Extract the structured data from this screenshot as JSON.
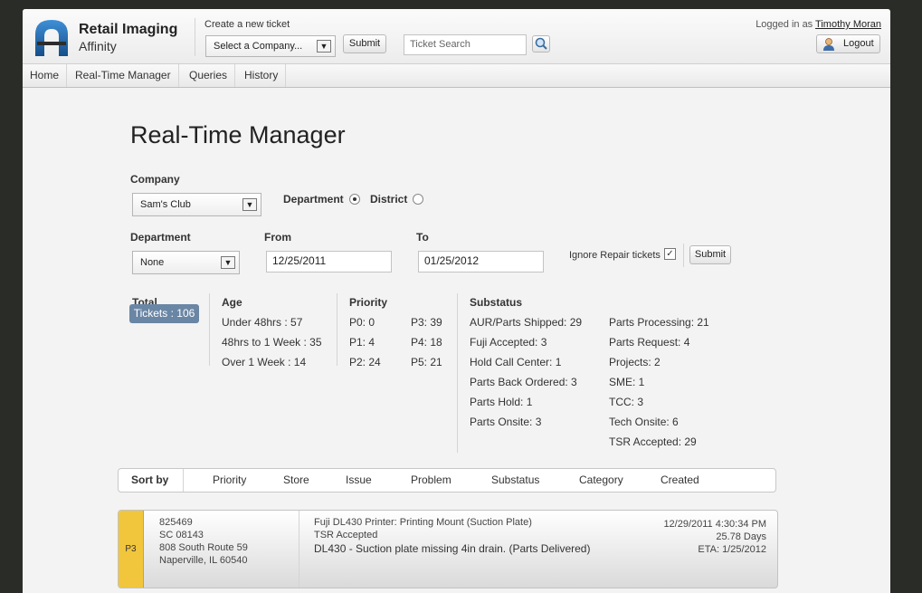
{
  "brand": {
    "title": "Retail Imaging",
    "subtitle": "Affinity"
  },
  "header": {
    "create_label": "Create a new ticket",
    "company_select": "Select a Company...",
    "submit": "Submit",
    "search_placeholder": "Ticket Search",
    "logged_prefix": "Logged in as",
    "user": "Timothy Moran",
    "logout": "Logout"
  },
  "nav": [
    "Home",
    "Real-Time Manager",
    "Queries",
    "History"
  ],
  "page_title": "Real-Time Manager",
  "filters": {
    "company_label": "Company",
    "company_value": "Sam's Club",
    "department_radio": "Department",
    "district_radio": "District",
    "mode_selected": "Department",
    "department_label": "Department",
    "department_value": "None",
    "from_label": "From",
    "from_value": "12/25/2011",
    "to_label": "To",
    "to_value": "01/25/2012",
    "ignore_repair_label": "Ignore Repair tickets",
    "ignore_repair_checked": true,
    "submit": "Submit"
  },
  "stats": {
    "total_label": "Total",
    "tickets": "Tickets : 106",
    "age_label": "Age",
    "age": [
      "Under 48hrs : 57",
      "48hrs to 1 Week : 35",
      "Over 1 Week : 14"
    ],
    "priority_label": "Priority",
    "priority_left": [
      "P0: 0",
      "P1: 4",
      "P2: 24"
    ],
    "priority_right": [
      "P3: 39",
      "P4: 18",
      "P5: 21"
    ],
    "substatus_label": "Substatus",
    "substatus_left": [
      "AUR/Parts Shipped: 29",
      "Fuji Accepted: 3",
      "Hold Call Center: 1",
      "Parts Back Ordered: 3",
      "Parts Hold: 1",
      "Parts Onsite: 3"
    ],
    "substatus_right": [
      "Parts Processing: 21",
      "Parts Request: 4",
      "Projects: 2",
      "SME: 1",
      "TCC: 3",
      "Tech Onsite: 6",
      "TSR Accepted: 29"
    ]
  },
  "sort": {
    "label": "Sort by",
    "items": [
      "Priority",
      "Store",
      "Issue",
      "Problem",
      "Substatus",
      "Category",
      "Created"
    ]
  },
  "ticket": {
    "priority": "P3",
    "id": "825469",
    "store": "SC 08143",
    "address": "808 South Route 59",
    "city": "Naperville, IL 60540",
    "category": "Fuji DL430 Printer: Printing Mount (Suction Plate)",
    "substatus": "TSR Accepted",
    "issue": "DL430 - Suction plate missing 4in drain. (Parts Delivered)",
    "created": "12/29/2011 4:30:34 PM",
    "age": "25.78 Days",
    "eta": "ETA: 1/25/2012"
  },
  "colors": {
    "priority_p3": "#f1c63c",
    "ticket_pill": "#6a86a5",
    "logo_blue": "#1d63a8"
  }
}
